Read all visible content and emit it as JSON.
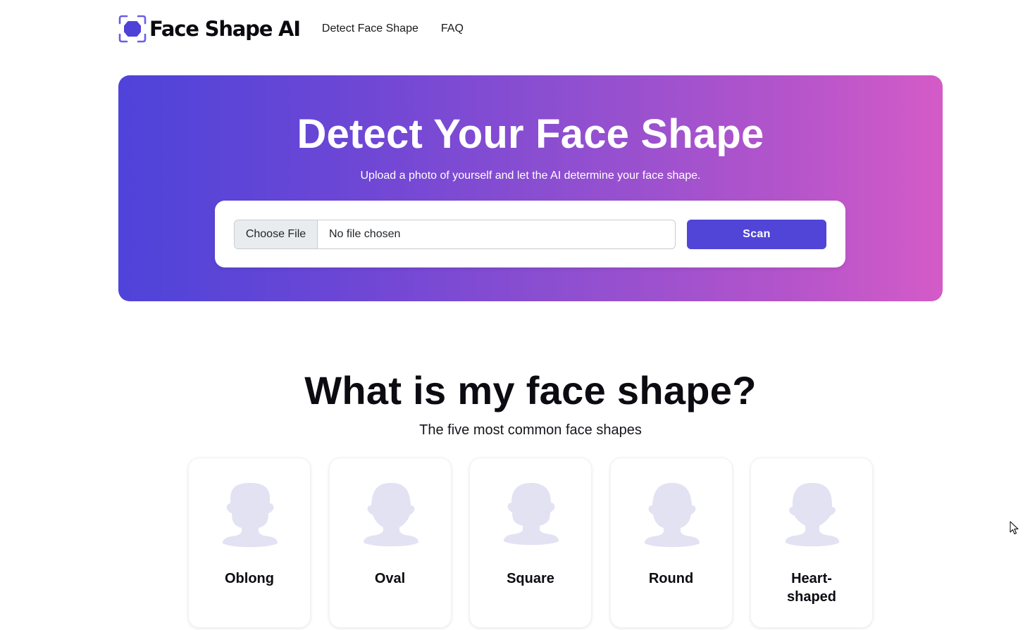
{
  "header": {
    "logo_icon": "face-scan-icon",
    "brand": "Face Shape AI",
    "nav": [
      {
        "label": "Detect Face Shape"
      },
      {
        "label": "FAQ"
      }
    ]
  },
  "hero": {
    "title": "Detect Your Face Shape",
    "subtitle": "Upload a photo of yourself and let the AI determine your face shape.",
    "file_input": {
      "button_label": "Choose File",
      "status": "No file chosen"
    },
    "scan_label": "Scan",
    "colors": {
      "gradient_start": "#5043d9",
      "gradient_end": "#d45bc7",
      "accent": "#5145d8"
    }
  },
  "section": {
    "title": "What is my face shape?",
    "subtitle": "The five most common face shapes",
    "shapes": [
      {
        "label": "Oblong",
        "icon": "oblong-face-silhouette-icon"
      },
      {
        "label": "Oval",
        "icon": "oval-face-silhouette-icon"
      },
      {
        "label": "Square",
        "icon": "square-face-silhouette-icon"
      },
      {
        "label": "Round",
        "icon": "round-face-silhouette-icon"
      },
      {
        "label": "Heart-shaped",
        "icon": "heart-face-silhouette-icon"
      }
    ],
    "silhouette_color": "#e3e2f3"
  }
}
